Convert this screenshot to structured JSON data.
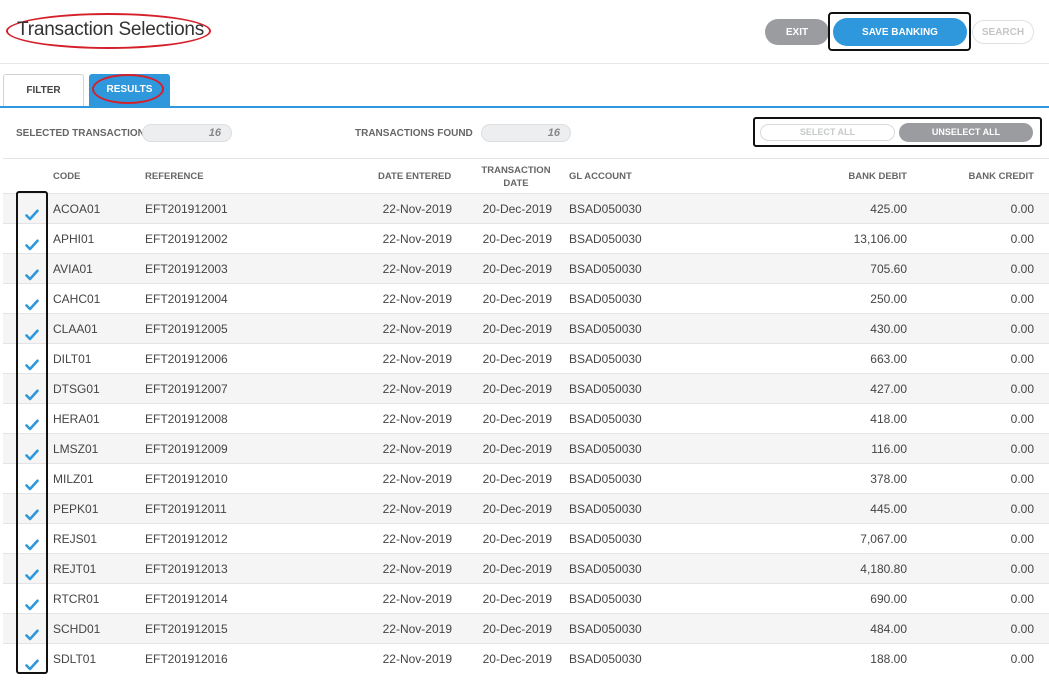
{
  "header": {
    "title": "Transaction Selections",
    "exit_label": "EXIT",
    "save_label": "SAVE BANKING",
    "search_label": "SEARCH"
  },
  "tabs": [
    {
      "label": "FILTER",
      "active": false
    },
    {
      "label": "RESULTS",
      "active": true
    }
  ],
  "summary": {
    "selected_label": "SELECTED TRANSACTION",
    "selected_value": "16",
    "found_label": "TRANSACTIONS FOUND",
    "found_value": "16",
    "select_all_label": "SELECT ALL",
    "unselect_all_label": "UNSELECT ALL"
  },
  "table": {
    "columns": {
      "code": "CODE",
      "reference": "REFERENCE",
      "date_entered": "DATE ENTERED",
      "transaction_date_line1": "TRANSACTION",
      "transaction_date_line2": "DATE",
      "gl_account": "GL ACCOUNT",
      "bank_debit": "BANK DEBIT",
      "bank_credit": "BANK CREDIT"
    },
    "rows": [
      {
        "checked": true,
        "code": "ACOA01",
        "reference": "EFT201912001",
        "date_entered": "22-Nov-2019",
        "transaction_date": "20-Dec-2019",
        "gl_account": "BSAD050030",
        "bank_debit": "425.00",
        "bank_credit": "0.00"
      },
      {
        "checked": true,
        "code": "APHI01",
        "reference": "EFT201912002",
        "date_entered": "22-Nov-2019",
        "transaction_date": "20-Dec-2019",
        "gl_account": "BSAD050030",
        "bank_debit": "13,106.00",
        "bank_credit": "0.00"
      },
      {
        "checked": true,
        "code": "AVIA01",
        "reference": "EFT201912003",
        "date_entered": "22-Nov-2019",
        "transaction_date": "20-Dec-2019",
        "gl_account": "BSAD050030",
        "bank_debit": "705.60",
        "bank_credit": "0.00"
      },
      {
        "checked": true,
        "code": "CAHC01",
        "reference": "EFT201912004",
        "date_entered": "22-Nov-2019",
        "transaction_date": "20-Dec-2019",
        "gl_account": "BSAD050030",
        "bank_debit": "250.00",
        "bank_credit": "0.00"
      },
      {
        "checked": true,
        "code": "CLAA01",
        "reference": "EFT201912005",
        "date_entered": "22-Nov-2019",
        "transaction_date": "20-Dec-2019",
        "gl_account": "BSAD050030",
        "bank_debit": "430.00",
        "bank_credit": "0.00"
      },
      {
        "checked": true,
        "code": "DILT01",
        "reference": "EFT201912006",
        "date_entered": "22-Nov-2019",
        "transaction_date": "20-Dec-2019",
        "gl_account": "BSAD050030",
        "bank_debit": "663.00",
        "bank_credit": "0.00"
      },
      {
        "checked": true,
        "code": "DTSG01",
        "reference": "EFT201912007",
        "date_entered": "22-Nov-2019",
        "transaction_date": "20-Dec-2019",
        "gl_account": "BSAD050030",
        "bank_debit": "427.00",
        "bank_credit": "0.00"
      },
      {
        "checked": true,
        "code": "HERA01",
        "reference": "EFT201912008",
        "date_entered": "22-Nov-2019",
        "transaction_date": "20-Dec-2019",
        "gl_account": "BSAD050030",
        "bank_debit": "418.00",
        "bank_credit": "0.00"
      },
      {
        "checked": true,
        "code": "LMSZ01",
        "reference": "EFT201912009",
        "date_entered": "22-Nov-2019",
        "transaction_date": "20-Dec-2019",
        "gl_account": "BSAD050030",
        "bank_debit": "116.00",
        "bank_credit": "0.00"
      },
      {
        "checked": true,
        "code": "MILZ01",
        "reference": "EFT201912010",
        "date_entered": "22-Nov-2019",
        "transaction_date": "20-Dec-2019",
        "gl_account": "BSAD050030",
        "bank_debit": "378.00",
        "bank_credit": "0.00"
      },
      {
        "checked": true,
        "code": "PEPK01",
        "reference": "EFT201912011",
        "date_entered": "22-Nov-2019",
        "transaction_date": "20-Dec-2019",
        "gl_account": "BSAD050030",
        "bank_debit": "445.00",
        "bank_credit": "0.00"
      },
      {
        "checked": true,
        "code": "REJS01",
        "reference": "EFT201912012",
        "date_entered": "22-Nov-2019",
        "transaction_date": "20-Dec-2019",
        "gl_account": "BSAD050030",
        "bank_debit": "7,067.00",
        "bank_credit": "0.00"
      },
      {
        "checked": true,
        "code": "REJT01",
        "reference": "EFT201912013",
        "date_entered": "22-Nov-2019",
        "transaction_date": "20-Dec-2019",
        "gl_account": "BSAD050030",
        "bank_debit": "4,180.80",
        "bank_credit": "0.00"
      },
      {
        "checked": true,
        "code": "RTCR01",
        "reference": "EFT201912014",
        "date_entered": "22-Nov-2019",
        "transaction_date": "20-Dec-2019",
        "gl_account": "BSAD050030",
        "bank_debit": "690.00",
        "bank_credit": "0.00"
      },
      {
        "checked": true,
        "code": "SCHD01",
        "reference": "EFT201912015",
        "date_entered": "22-Nov-2019",
        "transaction_date": "20-Dec-2019",
        "gl_account": "BSAD050030",
        "bank_debit": "484.00",
        "bank_credit": "0.00"
      },
      {
        "checked": true,
        "code": "SDLT01",
        "reference": "EFT201912016",
        "date_entered": "22-Nov-2019",
        "transaction_date": "20-Dec-2019",
        "gl_account": "BSAD050030",
        "bank_debit": "188.00",
        "bank_credit": "0.00"
      }
    ]
  },
  "colors": {
    "accent": "#2f98dc",
    "highlight_ring": "#d4202a",
    "highlight_box": "#111111",
    "button_grey": "#9a9c9f"
  },
  "icons": {
    "row_check": "checkmark-icon"
  }
}
